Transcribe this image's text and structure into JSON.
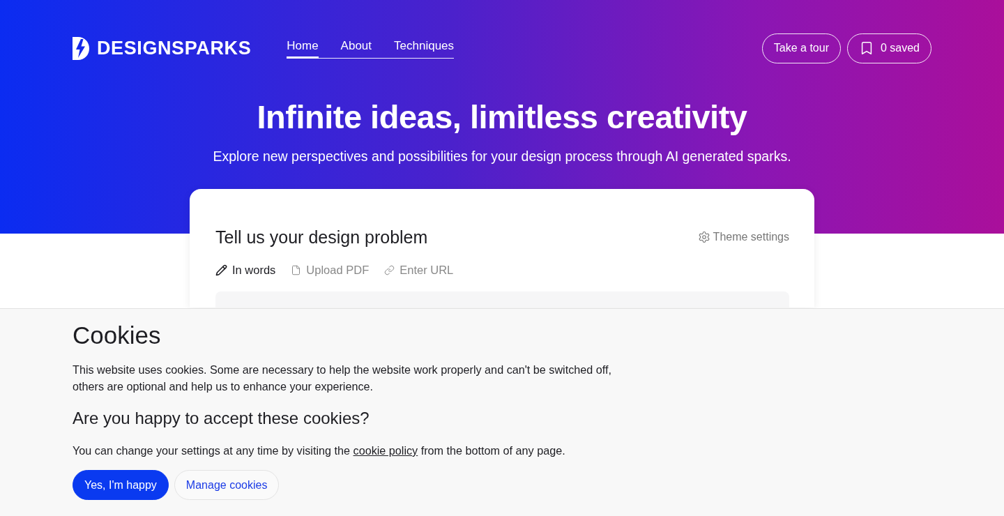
{
  "header": {
    "logo": "DESIGNSPARKS",
    "nav": [
      {
        "label": "Home",
        "selected": true
      },
      {
        "label": "About",
        "selected": false
      },
      {
        "label": "Techniques",
        "selected": false
      }
    ],
    "actions": [
      {
        "label": "Take a tour",
        "kind": "plain"
      },
      {
        "label": "0 saved",
        "kind": "saved"
      }
    ]
  },
  "hero": {
    "title": "Infinite ideas, limitless creativity",
    "subtitle": "Explore new perspectives and possibilities for your design process through AI generated sparks."
  },
  "card": {
    "title": "Tell us your design problem",
    "theme_settings": "Theme settings",
    "input_tabs": [
      {
        "label": "In words",
        "kind": "words",
        "selected": true
      },
      {
        "label": "Upload PDF",
        "kind": "pdf",
        "selected": false
      },
      {
        "label": "Enter URL",
        "kind": "url",
        "selected": false
      }
    ]
  },
  "cookie_banner": {
    "title": "Cookies",
    "text": "This website uses cookies. Some are necessary to help the website work properly and can't be switched off, others are optional and help us to enhance your experience.",
    "question": "Are you happy to accept these cookies?",
    "settings_text": {
      "before": "You can change your settings at any time by visiting the",
      "link": "cookie policy",
      "after": "from the bottom of any page."
    },
    "buttons": [
      {
        "label": "Yes, I'm happy",
        "kind": "primary"
      },
      {
        "label": "Manage cookies",
        "kind": "secondary"
      }
    ]
  }
}
